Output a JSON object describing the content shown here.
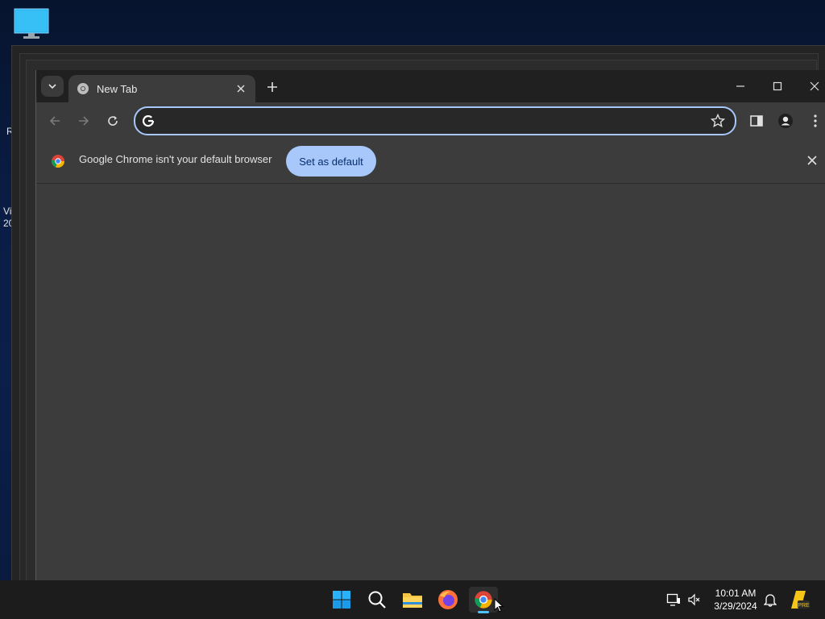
{
  "desktop": {
    "icons": [
      {
        "name": "this-pc",
        "icon": "monitor-icon"
      }
    ],
    "clipped_labels": [
      "R",
      "Vi",
      "20"
    ]
  },
  "browser": {
    "tab": {
      "title": "New Tab",
      "favicon": "chrome-newtab-icon"
    },
    "omnibox": {
      "value": "",
      "placeholder": ""
    },
    "infobar": {
      "message": "Google Chrome isn't your default browser",
      "button": "Set as default"
    },
    "colors": {
      "accent": "#a8c7fa",
      "frame": "#202020",
      "surface": "#3c3c3c"
    }
  },
  "taskbar": {
    "apps": [
      "start-icon",
      "search-icon",
      "file-explorer-icon",
      "firefox-icon",
      "chrome-icon"
    ],
    "time": "10:01 AM",
    "date": "3/29/2024",
    "tray_badge": "PRE"
  }
}
